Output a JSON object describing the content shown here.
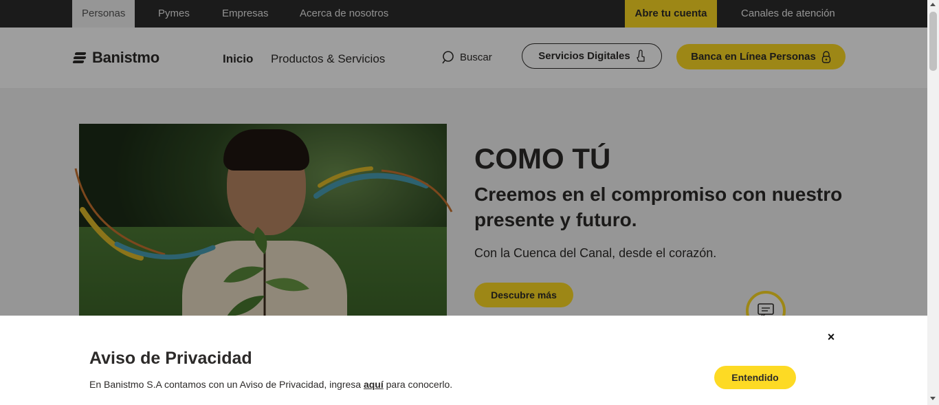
{
  "topbar": {
    "tabs": [
      "Personas",
      "Pymes",
      "Empresas",
      "Acerca de nosotros"
    ],
    "abre_cuenta": "Abre tu cuenta",
    "canales": "Canales de atención"
  },
  "header": {
    "logo": "Banistmo",
    "nav": [
      "Inicio",
      "Productos & Servicios"
    ],
    "search_label": "Buscar",
    "servicios_digitales": "Servicios Digitales",
    "banca_en_linea": "Banca en Línea Personas"
  },
  "hero": {
    "title": "COMO TÚ",
    "subtitle": "Creemos en el compromiso con nuestro presente y futuro.",
    "description": "Con la Cuenca del Canal, desde el corazón.",
    "button": "Descubre más"
  },
  "privacy": {
    "title": "Aviso de Privacidad",
    "text_before": "En Banistmo S.A contamos con un Aviso de Privacidad, ingresa ",
    "link": "aquí",
    "text_after": " para conocerlo.",
    "button": "Entendido",
    "close": "×"
  },
  "colors": {
    "brand_yellow": "#fdda24",
    "dark": "#2c2a29",
    "topbar": "#2d2d2d"
  }
}
